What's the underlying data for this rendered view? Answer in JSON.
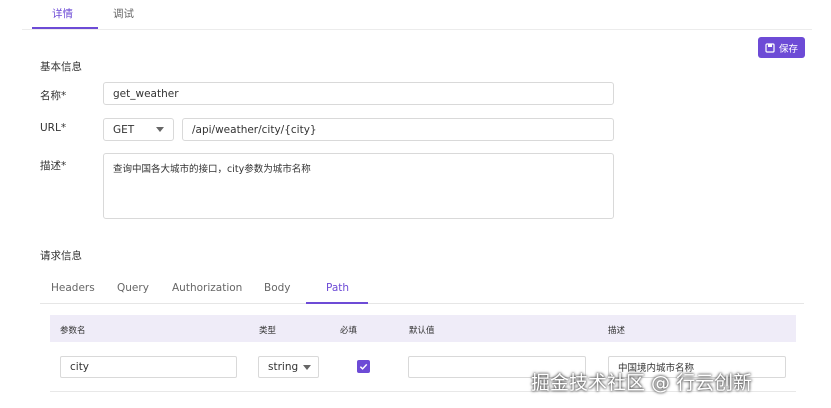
{
  "top_tabs": {
    "details": "详情",
    "debug": "调试"
  },
  "toolbar": {
    "save_label": "保存"
  },
  "basic_info": {
    "title": "基本信息",
    "name_label": "名称*",
    "name_value": "get_weather",
    "url_label": "URL*",
    "method_value": "GET",
    "path_value": "/api/weather/city/{city}",
    "desc_label": "描述*",
    "desc_value": "查询中国各大城市的接口，city参数为城市名称"
  },
  "request_info": {
    "title": "请求信息",
    "tabs": [
      "Headers",
      "Query",
      "Authorization",
      "Body",
      "Path"
    ],
    "active_tab": "Path"
  },
  "params_table": {
    "headers": [
      "参数名",
      "类型",
      "必填",
      "默认值",
      "描述"
    ],
    "rows": [
      {
        "name": "city",
        "type": "string",
        "required": true,
        "default": "",
        "desc": "中国境内城市名称"
      }
    ]
  },
  "watermark": "掘金技术社区 @ 行云创新",
  "colors": {
    "accent": "#6d4bd6",
    "table_header_bg": "#efecf8"
  }
}
